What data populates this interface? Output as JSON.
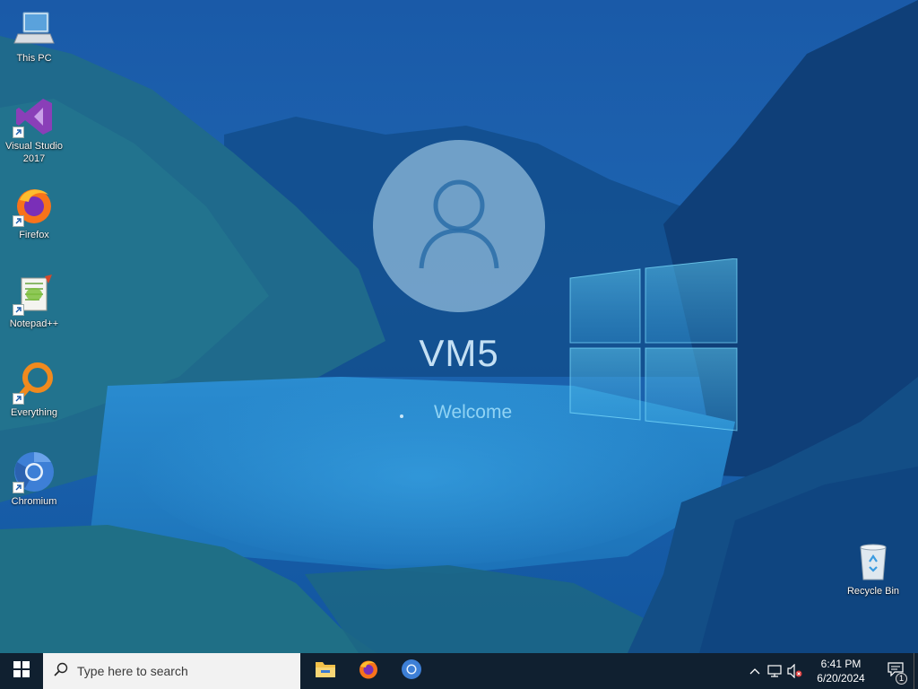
{
  "desktop": {
    "icons": [
      {
        "label": "This PC",
        "icon": "computer-icon"
      },
      {
        "label": "Visual Studio 2017",
        "icon": "visual-studio-icon"
      },
      {
        "label": "Firefox",
        "icon": "firefox-icon"
      },
      {
        "label": "Notepad++",
        "icon": "notepad-plus-plus-icon"
      },
      {
        "label": "Everything",
        "icon": "everything-search-icon"
      },
      {
        "label": "Chromium",
        "icon": "chromium-icon"
      },
      {
        "label": "Recycle Bin",
        "icon": "recycle-bin-icon"
      }
    ]
  },
  "welcome_screen": {
    "username": "VM5",
    "status": "Welcome"
  },
  "taskbar": {
    "search_placeholder": "Type here to search",
    "pinned_apps": [
      "file-explorer-icon",
      "firefox-icon",
      "chromium-icon"
    ],
    "tray_icons": [
      "chevron-up-icon",
      "network-icon",
      "volume-muted-icon"
    ],
    "clock": {
      "time": "6:41 PM",
      "date": "6/20/2024"
    },
    "notification_count": "1"
  },
  "colors": {
    "accent": "#1e7fd0",
    "taskbar": "#101c28",
    "search_box": "#f2f2f2"
  }
}
